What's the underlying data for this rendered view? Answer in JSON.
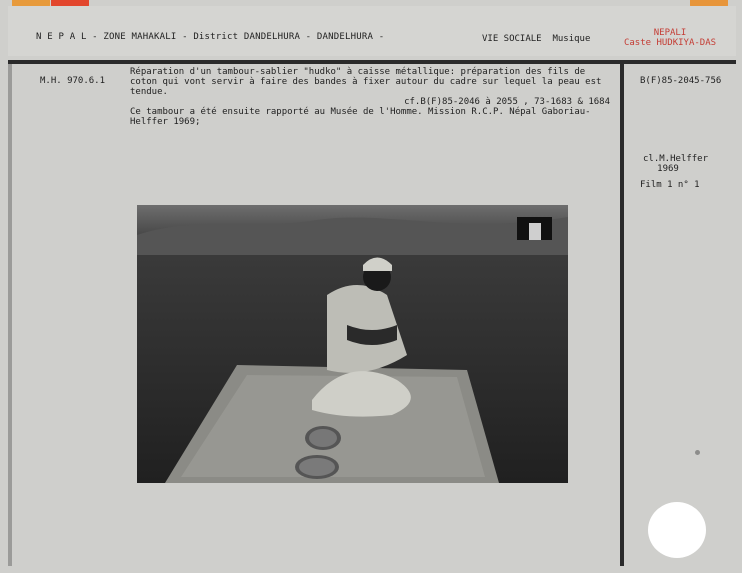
{
  "header": {
    "location": "N E P A L - ZONE MAHAKALI - District DANDELHURA - DANDELHURA -",
    "category": "VIE SOCIALE  Musique",
    "country": "NEPALI",
    "caste": "Caste HUDKIYA-DAS"
  },
  "record": {
    "inventory_number": "M.H. 970.6.1",
    "description": "Réparation d'un tambour-sablier \"hudko\" à caisse métallique: préparation des fils de coton qui vont servir à faire des bandes à fixer autour du cadre sur lequel la peau est tendue.",
    "related_refs": "cf.B(F)85-2046 à 2055 , 73-1683 & 1684",
    "note": "Ce tambour a été ensuite rapporté au Musée de l'Homme. Mission R.C.P. Népal Gaboriau-Helffer 1969;",
    "photo_ref": "B(F)85-2045-756",
    "credit": "cl.M.Helffer 1969",
    "film": "Film 1 n° 1"
  },
  "colors": {
    "card": "#cfcfcc",
    "rule": "#2b2b2b",
    "accent_red": "#c43d35",
    "tab_orange": "#e79a3b"
  },
  "icons": [
    "binder-hole",
    "color-tab"
  ]
}
